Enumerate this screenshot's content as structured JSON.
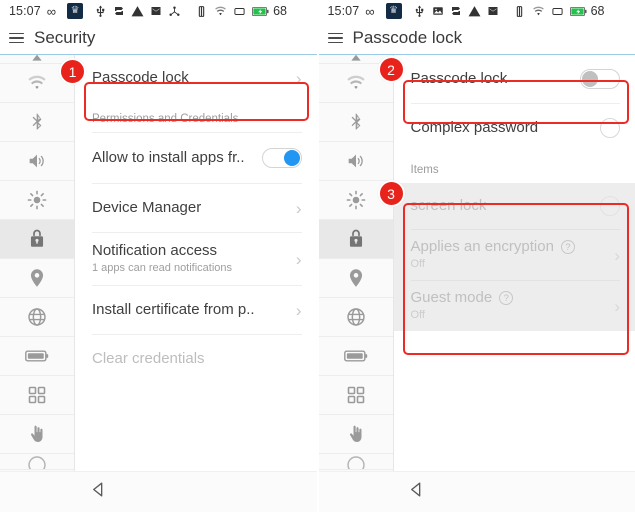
{
  "left": {
    "statusbar": {
      "time": "15:07",
      "infinity_icon": "infinity-icon",
      "crown_icon": "crown-icon",
      "icons": [
        "usb-icon",
        "sync-icon",
        "warning-icon",
        "mail-icon",
        "share-icon",
        "vibrate-icon",
        "wifi-icon",
        "sim-icon",
        "battery-icon"
      ],
      "battery_level": "68"
    },
    "titlebar": {
      "menu_icon": "hamburger-icon",
      "title": "Security"
    },
    "rail": [
      {
        "icon": "wifi-icon",
        "active": false
      },
      {
        "icon": "bluetooth-icon",
        "active": false
      },
      {
        "icon": "volume-icon",
        "active": false
      },
      {
        "icon": "brightness-icon",
        "active": false
      },
      {
        "icon": "lock-icon",
        "active": true
      },
      {
        "icon": "location-icon",
        "active": false
      },
      {
        "icon": "globe-icon",
        "active": false
      },
      {
        "icon": "battery-icon",
        "active": false
      },
      {
        "icon": "apps-grid-icon",
        "active": false
      },
      {
        "icon": "touch-hand-icon",
        "active": false
      }
    ],
    "rows": {
      "passcode_lock": "Passcode lock",
      "section_permissions": "Permissions and Credentials",
      "allow_install": "Allow to install apps fr..",
      "device_manager": "Device Manager",
      "notification_access": "Notification access",
      "notification_access_sub": "1 apps can read notifications",
      "install_certificate": "Install certificate from p..",
      "clear_credentials": "Clear credentials"
    },
    "navbar": {
      "back_icon": "back-triangle-icon"
    },
    "annotation": {
      "badge": "1"
    }
  },
  "right": {
    "statusbar": {
      "time": "15:07",
      "infinity_icon": "infinity-icon",
      "crown_icon": "crown-icon",
      "icons": [
        "usb-icon",
        "image-icon",
        "sync-icon",
        "warning-icon",
        "mail-icon",
        "vibrate-icon",
        "wifi-icon",
        "sim-icon",
        "battery-icon"
      ],
      "battery_level": "68"
    },
    "titlebar": {
      "menu_icon": "hamburger-icon",
      "title": "Passcode lock"
    },
    "rail": [
      {
        "icon": "wifi-icon",
        "active": false
      },
      {
        "icon": "bluetooth-icon",
        "active": false
      },
      {
        "icon": "volume-icon",
        "active": false
      },
      {
        "icon": "brightness-icon",
        "active": false
      },
      {
        "icon": "lock-icon",
        "active": true
      },
      {
        "icon": "location-icon",
        "active": false
      },
      {
        "icon": "globe-icon",
        "active": false
      },
      {
        "icon": "battery-icon",
        "active": false
      },
      {
        "icon": "apps-grid-icon",
        "active": false
      },
      {
        "icon": "touch-hand-icon",
        "active": false
      }
    ],
    "rows": {
      "passcode_lock": "Passcode lock",
      "complex_password": "Complex password",
      "section_items": "Items",
      "screen_lock": "screen lock",
      "applies_encryption": "Applies an encryption",
      "applies_encryption_sub": "Off",
      "guest_mode": "Guest mode",
      "guest_mode_sub": "Off"
    },
    "navbar": {
      "back_icon": "back-triangle-icon"
    },
    "annotations": {
      "badge_top": "2",
      "badge_items": "3"
    }
  },
  "colors": {
    "accent_blue": "#2196f3",
    "annotation_red": "#e8231c",
    "title_underline": "#9ccbe8",
    "rail_active_bg": "#e8e8e8"
  }
}
